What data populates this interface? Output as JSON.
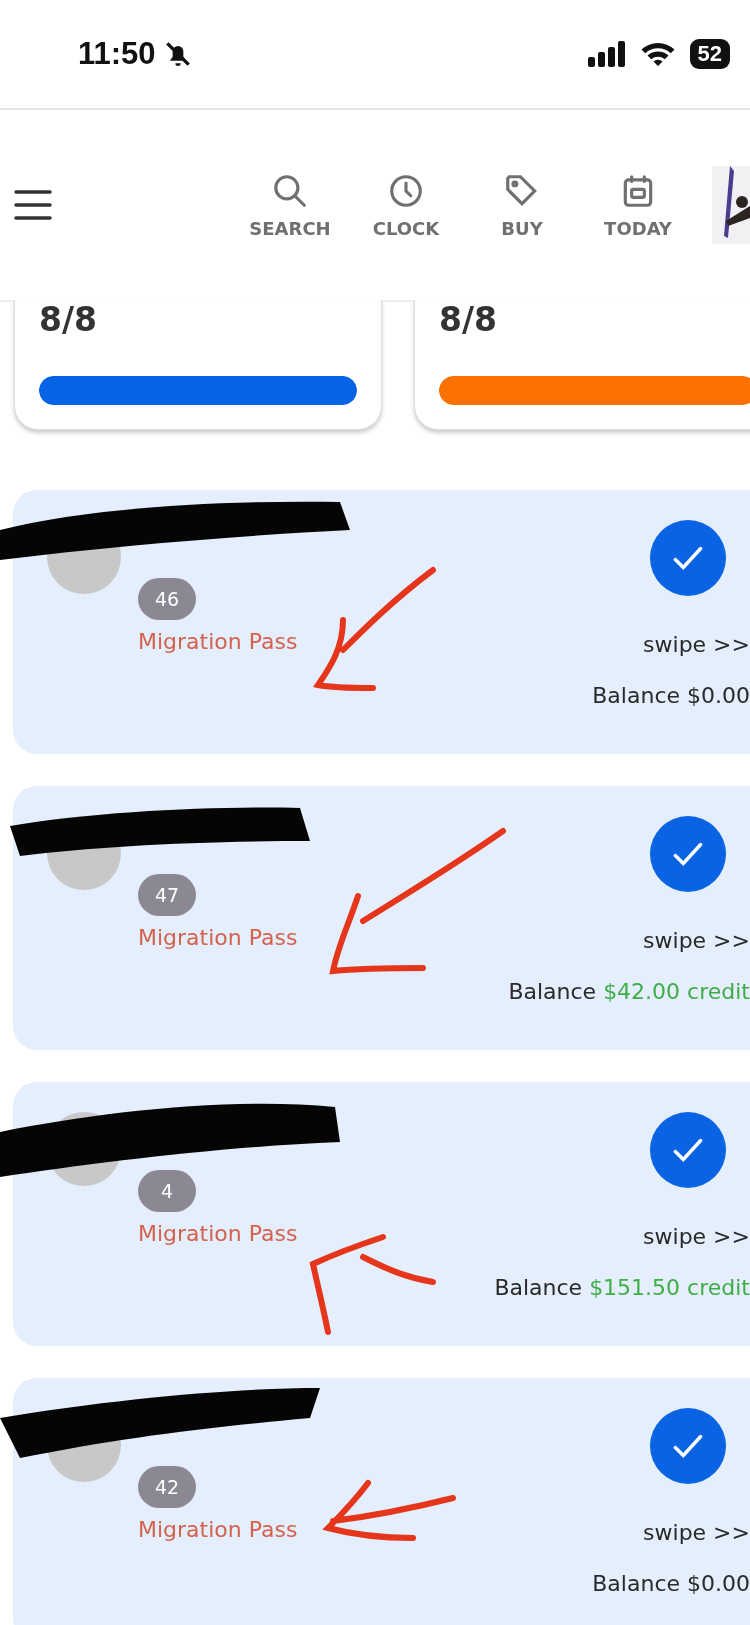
{
  "status_bar": {
    "time": "11:50",
    "battery": "52"
  },
  "nav": {
    "items": [
      {
        "kind": "search",
        "label": "SEARCH"
      },
      {
        "kind": "clock",
        "label": "CLOCK"
      },
      {
        "kind": "tag",
        "label": "BUY"
      },
      {
        "kind": "calendar",
        "label": "TODAY"
      }
    ]
  },
  "stats": [
    {
      "value": "8/8",
      "level": 1,
      "color": "#0763e5"
    },
    {
      "value": "8/8",
      "level": 1,
      "color": "#fb7203"
    }
  ],
  "members": [
    {
      "count": "46",
      "pass": "Migration Pass",
      "checked": true,
      "swipe": "swipe >>",
      "balance_label": "Balance",
      "balance": "$0.00",
      "credit": false
    },
    {
      "count": "47",
      "pass": "Migration Pass",
      "checked": true,
      "swipe": "swipe >>",
      "balance_label": "Balance",
      "balance": "$42.00 credit",
      "credit": true
    },
    {
      "count": "4",
      "pass": "Migration Pass",
      "checked": true,
      "swipe": "swipe >>",
      "balance_label": "Balance",
      "balance": "$151.50 credit",
      "credit": true
    },
    {
      "count": "42",
      "pass": "Migration Pass",
      "checked": true,
      "swipe": "swipe >>",
      "balance_label": "Balance",
      "balance": "$0.00",
      "credit": false
    }
  ]
}
